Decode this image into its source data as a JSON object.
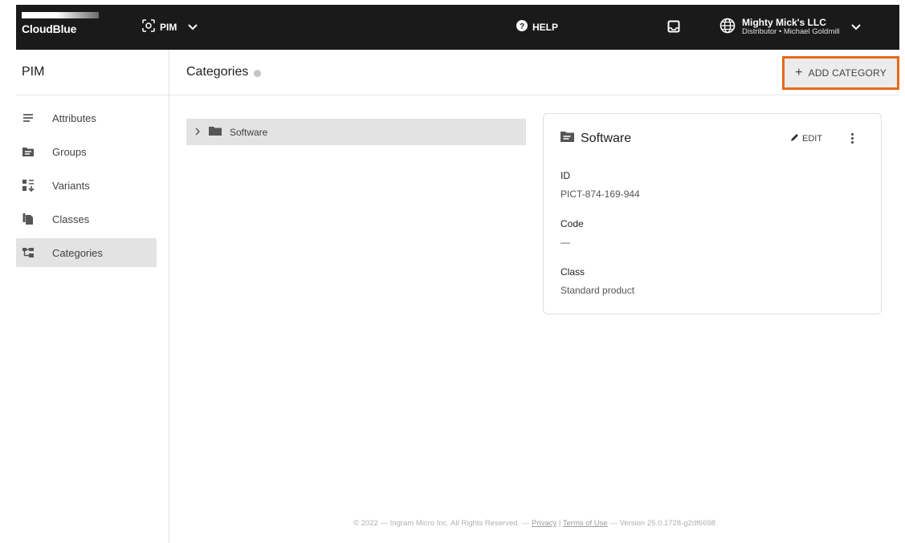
{
  "topbar": {
    "logo_text": "CloudBlue",
    "module": {
      "icon": "module-scan-icon",
      "label": "PIM"
    },
    "help_label": "HELP",
    "account": {
      "name": "Mighty Mick's LLC",
      "role": "Distributor • Michael Goldmill"
    }
  },
  "sidebar": {
    "title": "PIM",
    "items": [
      {
        "label": "Attributes",
        "icon": "list-icon"
      },
      {
        "label": "Groups",
        "icon": "folder-list-icon"
      },
      {
        "label": "Variants",
        "icon": "variants-icon"
      },
      {
        "label": "Classes",
        "icon": "copy-icon"
      },
      {
        "label": "Categories",
        "icon": "tree-icon",
        "active": true
      }
    ]
  },
  "page": {
    "title": "Categories",
    "add_button_label": "ADD CATEGORY"
  },
  "tree": {
    "items": [
      {
        "label": "Software",
        "icon": "folder-icon",
        "expanded": false
      }
    ]
  },
  "detail": {
    "title": "Software",
    "edit_label": "EDIT",
    "fields": [
      {
        "label": "ID",
        "value": "PICT-874-169-944"
      },
      {
        "label": "Code",
        "value": "—"
      },
      {
        "label": "Class",
        "value": "Standard product"
      }
    ]
  },
  "footer": {
    "prefix": "© 2022 — Ingram Micro Inc. All Rights Reserved. —",
    "privacy": "Privacy",
    "separator": "|",
    "terms": "Terms of Use",
    "version": "— Version 25.0.1728-g2df6698"
  },
  "colors": {
    "highlight": "#e8691a",
    "topbar": "#1a1a1a",
    "active_bg": "#e3e3e3"
  }
}
